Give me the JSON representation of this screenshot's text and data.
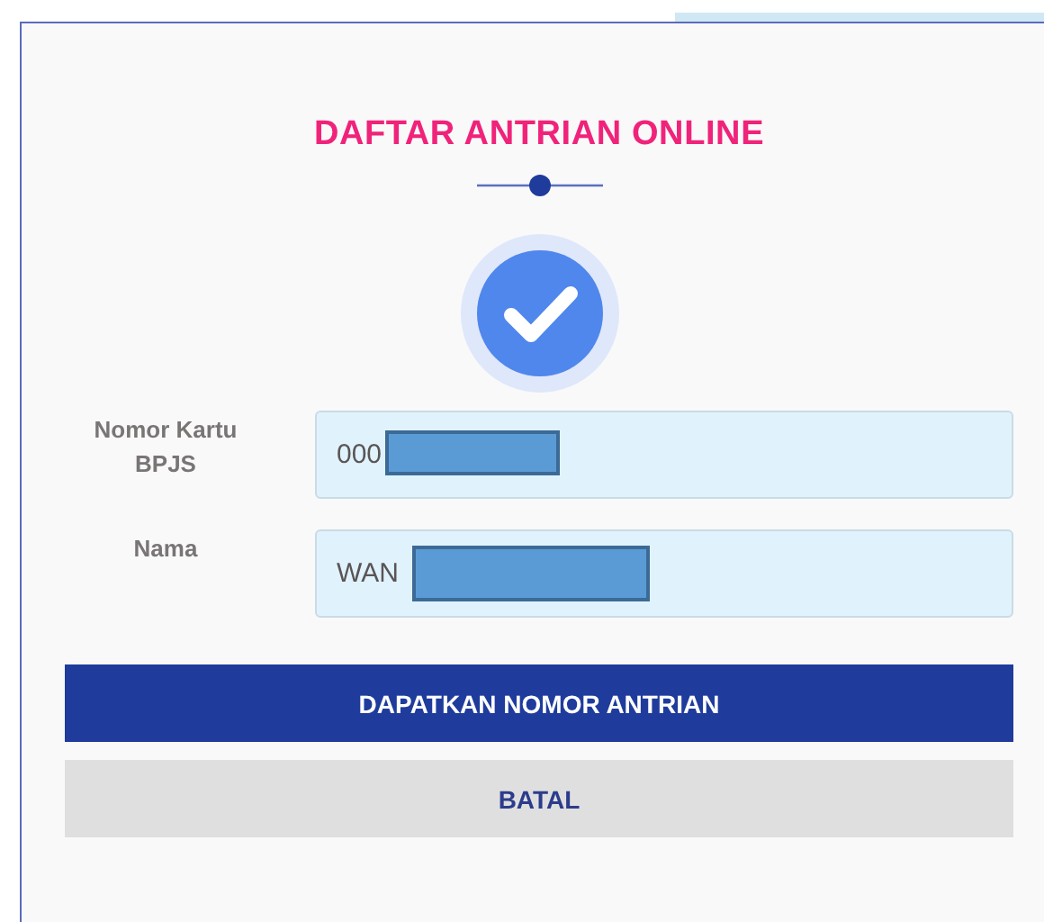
{
  "title": "DAFTAR ANTRIAN ONLINE",
  "fields": [
    {
      "label": "Nomor Kartu BPJS",
      "value": "000",
      "redacted": true
    },
    {
      "label": "Nama",
      "value": "WAN",
      "redacted": true
    }
  ],
  "buttons": [
    {
      "label": "DAPATKAN NOMOR ANTRIAN",
      "kind": "primary"
    },
    {
      "label": "BATAL",
      "kind": "secondary"
    }
  ]
}
